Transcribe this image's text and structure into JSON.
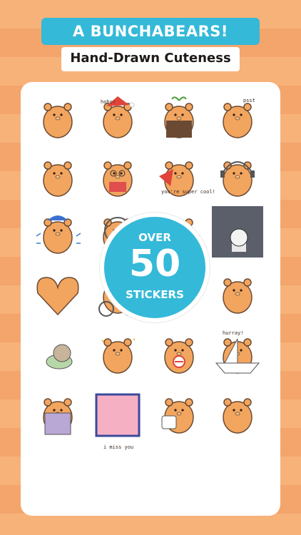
{
  "header": {
    "title": "A BUNCHABEARS!",
    "subtitle": "Hand-Drawn Cuteness"
  },
  "badge": {
    "line1": "OVER",
    "number": "50",
    "line2": "STICKERS"
  },
  "captions": {
    "hoho": "hoho!",
    "psst": "psst",
    "super_cool": "you're super cool!",
    "hurray": "hurray!",
    "i_miss_you": "i miss you"
  },
  "stickers": [
    {
      "name": "sticker-bear-thinking",
      "pose": "thinking"
    },
    {
      "name": "sticker-bear-santa-hat",
      "pose": "santa"
    },
    {
      "name": "sticker-bear-in-pot",
      "pose": "pot"
    },
    {
      "name": "sticker-bear-peeking",
      "pose": "peek"
    },
    {
      "name": "sticker-bear-big-belly",
      "pose": "big"
    },
    {
      "name": "sticker-bear-reading-glasses",
      "pose": "reading"
    },
    {
      "name": "sticker-bear-superhero-flying",
      "pose": "flying"
    },
    {
      "name": "sticker-bear-headphones",
      "pose": "headphones"
    },
    {
      "name": "sticker-bear-cold-hat",
      "pose": "cold"
    },
    {
      "name": "sticker-bear-astronaut",
      "pose": "astronaut"
    },
    {
      "name": "sticker-bear-eating",
      "pose": "eating"
    },
    {
      "name": "sticker-bear-office-desk",
      "pose": "office"
    },
    {
      "name": "sticker-bear-heart-arms",
      "pose": "heart"
    },
    {
      "name": "sticker-bear-bicycle",
      "pose": "bicycle"
    },
    {
      "name": "sticker-bears-hugging",
      "pose": "hug"
    },
    {
      "name": "sticker-bear-hurray",
      "pose": "hurray"
    },
    {
      "name": "sticker-snail",
      "pose": "snail"
    },
    {
      "name": "sticker-bear-thumbs-up",
      "pose": "thumbs"
    },
    {
      "name": "sticker-bear-no-sign",
      "pose": "nosign"
    },
    {
      "name": "sticker-bear-paper-boat",
      "pose": "boat"
    },
    {
      "name": "sticker-bear-trash-can",
      "pose": "trash"
    },
    {
      "name": "sticker-bear-window-miss-you",
      "pose": "window"
    },
    {
      "name": "sticker-bear-coffee-mug",
      "pose": "mug"
    },
    {
      "name": "sticker-bear-bored",
      "pose": "bored"
    }
  ],
  "colors": {
    "background_stripe_light": "#f7b27a",
    "background_stripe_dark": "#f3a56b",
    "accent_blue": "#34b9d8",
    "bear_fill": "#f2a55e",
    "bear_outline": "#6b4a34"
  }
}
